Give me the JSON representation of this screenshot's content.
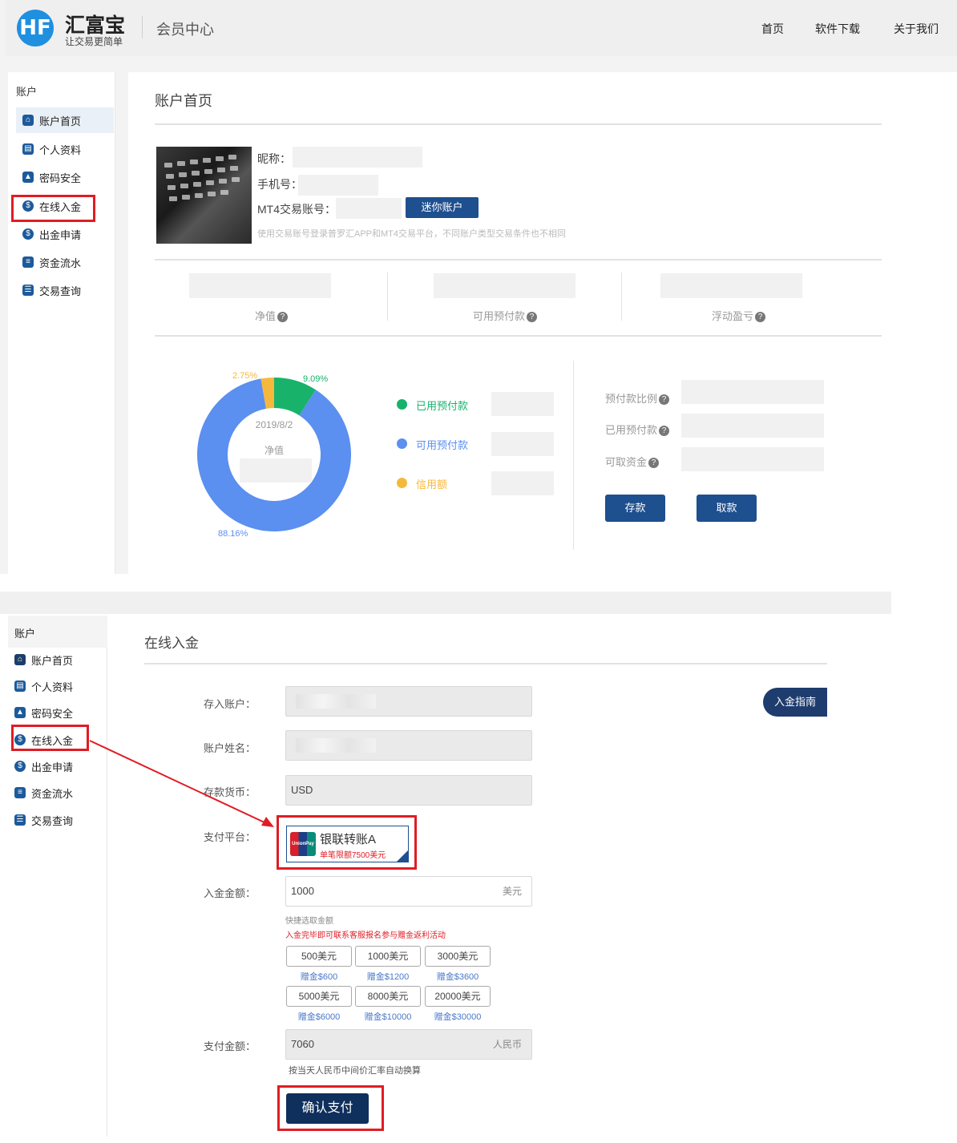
{
  "header": {
    "logo_letter": "HF",
    "brand_name": "汇富宝",
    "brand_slogan": "让交易更简单",
    "center_title": "会员中心",
    "nav": [
      "首页",
      "软件下载",
      "关于我们"
    ]
  },
  "sidebar": {
    "heading": "账户",
    "items": [
      {
        "label": "账户首页",
        "icon": "home-icon"
      },
      {
        "label": "个人资料",
        "icon": "id-card-icon"
      },
      {
        "label": "密码安全",
        "icon": "lock-icon"
      },
      {
        "label": "在线入金",
        "icon": "deposit-icon"
      },
      {
        "label": "出金申请",
        "icon": "withdraw-icon"
      },
      {
        "label": "资金流水",
        "icon": "fund-flow-icon"
      },
      {
        "label": "交易查询",
        "icon": "trade-query-icon"
      }
    ]
  },
  "account_home": {
    "title": "账户首页",
    "nickname_label": "昵称：",
    "phone_label": "手机号：",
    "mt4_label": "MT4交易账号：",
    "mini_account_button": "迷你账户",
    "hint": "使用交易账号登录普罗汇APP和MT4交易平台，不同账户类型交易条件也不相同",
    "stats": [
      "净值",
      "可用预付款",
      "浮动盈亏"
    ],
    "chart_date": "2019/8/2",
    "chart_center_label": "净值",
    "legend": [
      "已用预付款",
      "可用预付款",
      "信用额"
    ],
    "right_labels": [
      "预付款比例",
      "已用预付款",
      "可取资金"
    ],
    "deposit_button": "存款",
    "withdraw_button": "取款"
  },
  "chart_data": {
    "type": "pie",
    "categories": [
      "已用预付款",
      "可用预付款",
      "信用额"
    ],
    "values": [
      9.09,
      88.16,
      2.75
    ],
    "labels": [
      "9.09%",
      "88.16%",
      "2.75%"
    ],
    "colors": [
      "#19b26b",
      "#5b8ff0",
      "#f5b83d"
    ]
  },
  "online_deposit": {
    "title": "在线入金",
    "guide_button": "入金指南",
    "deposit_account_label": "存入账户：",
    "account_name_label": "账户姓名：",
    "currency_label": "存款货币：",
    "currency_value": "USD",
    "platform_label": "支付平台：",
    "platform_name": "银联转账A",
    "platform_limit": "单笔限额7500美元",
    "unionpay_text": "UnionPay",
    "amount_label": "入金金额：",
    "amount_value": "1000",
    "amount_unit": "美元",
    "quick_title": "快捷选取金额",
    "promo": "入金完毕即可联系客服报名参与赠金返利活动",
    "quick_amounts": [
      {
        "amount": "500美元",
        "bonus": "赠金$600"
      },
      {
        "amount": "1000美元",
        "bonus": "赠金$1200"
      },
      {
        "amount": "3000美元",
        "bonus": "赠金$3600"
      },
      {
        "amount": "5000美元",
        "bonus": "赠金$6000"
      },
      {
        "amount": "8000美元",
        "bonus": "赠金$10000"
      },
      {
        "amount": "20000美元",
        "bonus": "赠金$30000"
      }
    ],
    "pay_amount_label": "支付金额：",
    "pay_amount_value": "7060",
    "pay_unit": "人民币",
    "rate_note": "按当天人民币中间价汇率自动换算",
    "confirm_button": "确认支付"
  },
  "colors": {
    "accent": "#1e4f8f",
    "highlight": "#e01c24"
  }
}
